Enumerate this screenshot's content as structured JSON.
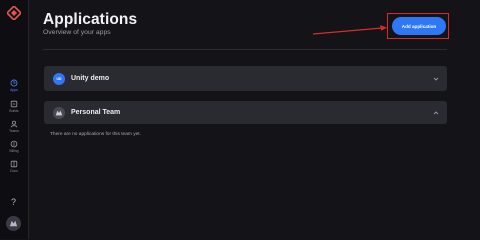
{
  "page": {
    "title": "Applications",
    "subtitle": "Overview of your apps",
    "add_button_label": "Add application",
    "empty_message": "There are no applications for this team yet."
  },
  "sidebar": {
    "items": [
      {
        "label": "Apps",
        "icon": "apps-icon",
        "active": true
      },
      {
        "label": "Builds",
        "icon": "builds-icon",
        "active": false
      },
      {
        "label": "Teams",
        "icon": "teams-icon",
        "active": false
      },
      {
        "label": "Billing",
        "icon": "billing-icon",
        "active": false
      },
      {
        "label": "Docs",
        "icon": "docs-icon",
        "active": false
      }
    ],
    "help_label": "?"
  },
  "apps": [
    {
      "badge": "UD",
      "name": "Unity demo",
      "expanded": false
    }
  ],
  "team": {
    "name": "Personal Team",
    "expanded": true
  },
  "colors": {
    "accent": "#2f78f5",
    "highlight": "#d82c2c",
    "background": "#141418",
    "panel": "#2a2a31"
  }
}
